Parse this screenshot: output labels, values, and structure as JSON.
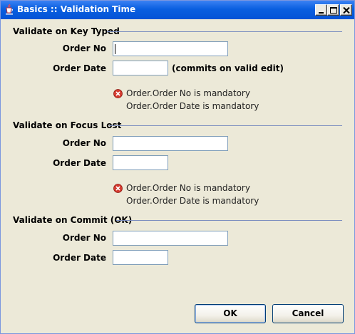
{
  "window": {
    "title": "Basics :: Validation Time",
    "controls": {
      "minimize": "minimize",
      "maximize": "maximize",
      "close": "close"
    }
  },
  "labels": {
    "order_no": "Order No",
    "order_date": "Order Date"
  },
  "sections": [
    {
      "title": "Validate on Key Typed",
      "order_no_value": "",
      "order_date_value": "",
      "hint": "(commits on valid edit)",
      "errors": [
        "Order.Order No is mandatory",
        "Order.Order Date is mandatory"
      ]
    },
    {
      "title": "Validate on Focus Lost",
      "order_no_value": "",
      "order_date_value": "",
      "errors": [
        "Order.Order No is mandatory",
        "Order.Order Date is mandatory"
      ]
    },
    {
      "title": "Validate on Commit (OK)",
      "order_no_value": "",
      "order_date_value": ""
    }
  ],
  "buttons": {
    "ok": "OK",
    "cancel": "Cancel"
  },
  "colors": {
    "title_bar": "#0a5fe0",
    "dialog_background": "#ece9d8",
    "separator": "#7a8dbf",
    "error_icon": "#d43a2f",
    "button_border": "#003c74"
  },
  "icons": {
    "app": "java-cup-icon",
    "error": "error-x-icon"
  }
}
